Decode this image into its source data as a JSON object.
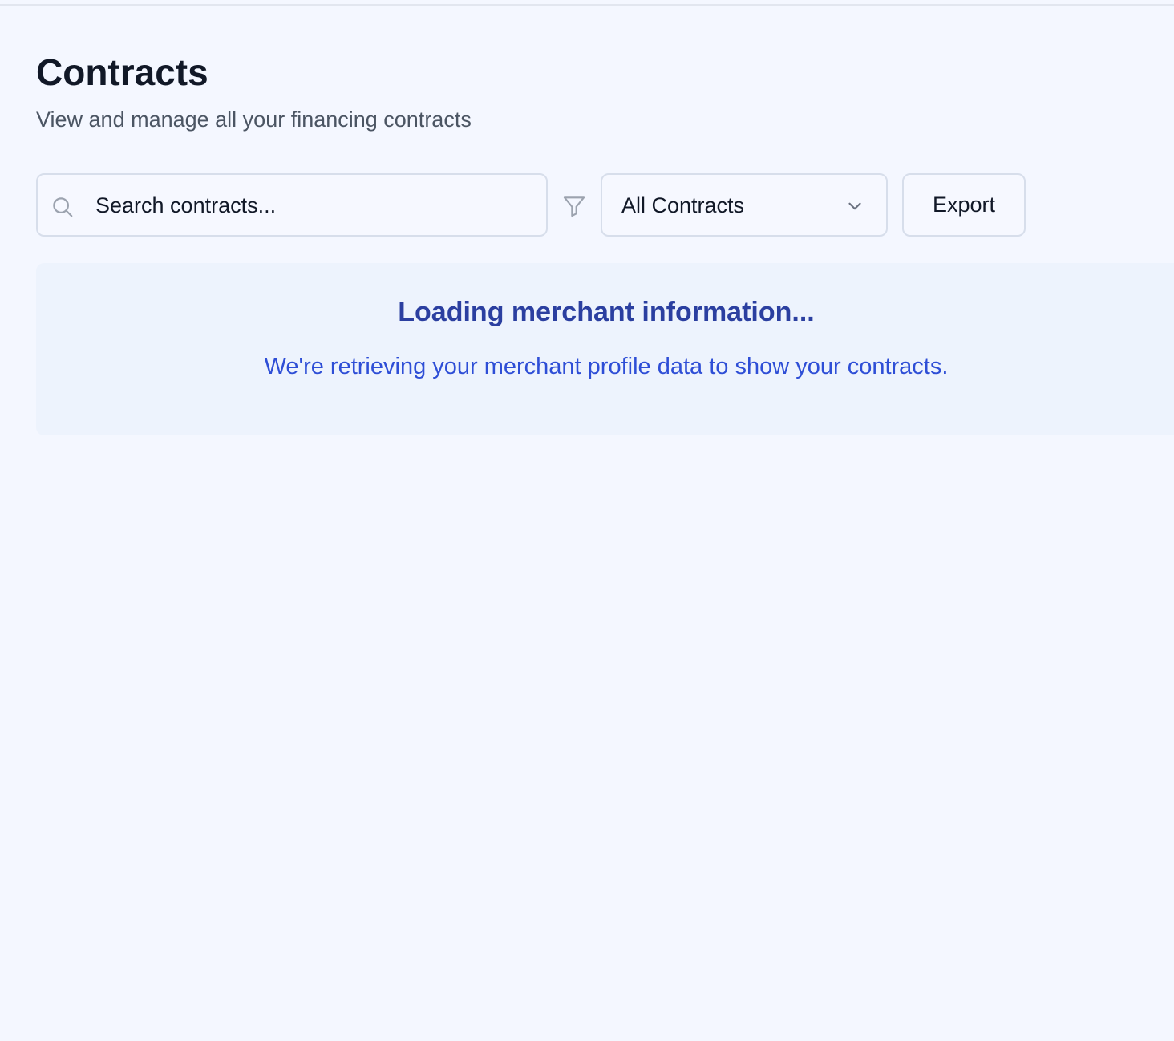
{
  "header": {
    "title": "Contracts",
    "subtitle": "View and manage all your financing contracts"
  },
  "toolbar": {
    "search": {
      "placeholder": "Search contracts...",
      "value": "",
      "icon": "search-icon"
    },
    "filter_icon": "filter-icon",
    "status_filter": {
      "selected": "All Contracts",
      "icon": "chevron-down-icon"
    },
    "export_label": "Export"
  },
  "loading": {
    "title": "Loading merchant information...",
    "message": "We're retrieving your merchant profile data to show your contracts."
  },
  "colors": {
    "background": "#f4f7ff",
    "title_text": "#111827",
    "subtitle_text": "#4b5563",
    "border": "#d7deeb",
    "loading_panel_bg": "#edf3fd",
    "loading_title": "#2b3fa0",
    "loading_message": "#2e4ed6"
  }
}
